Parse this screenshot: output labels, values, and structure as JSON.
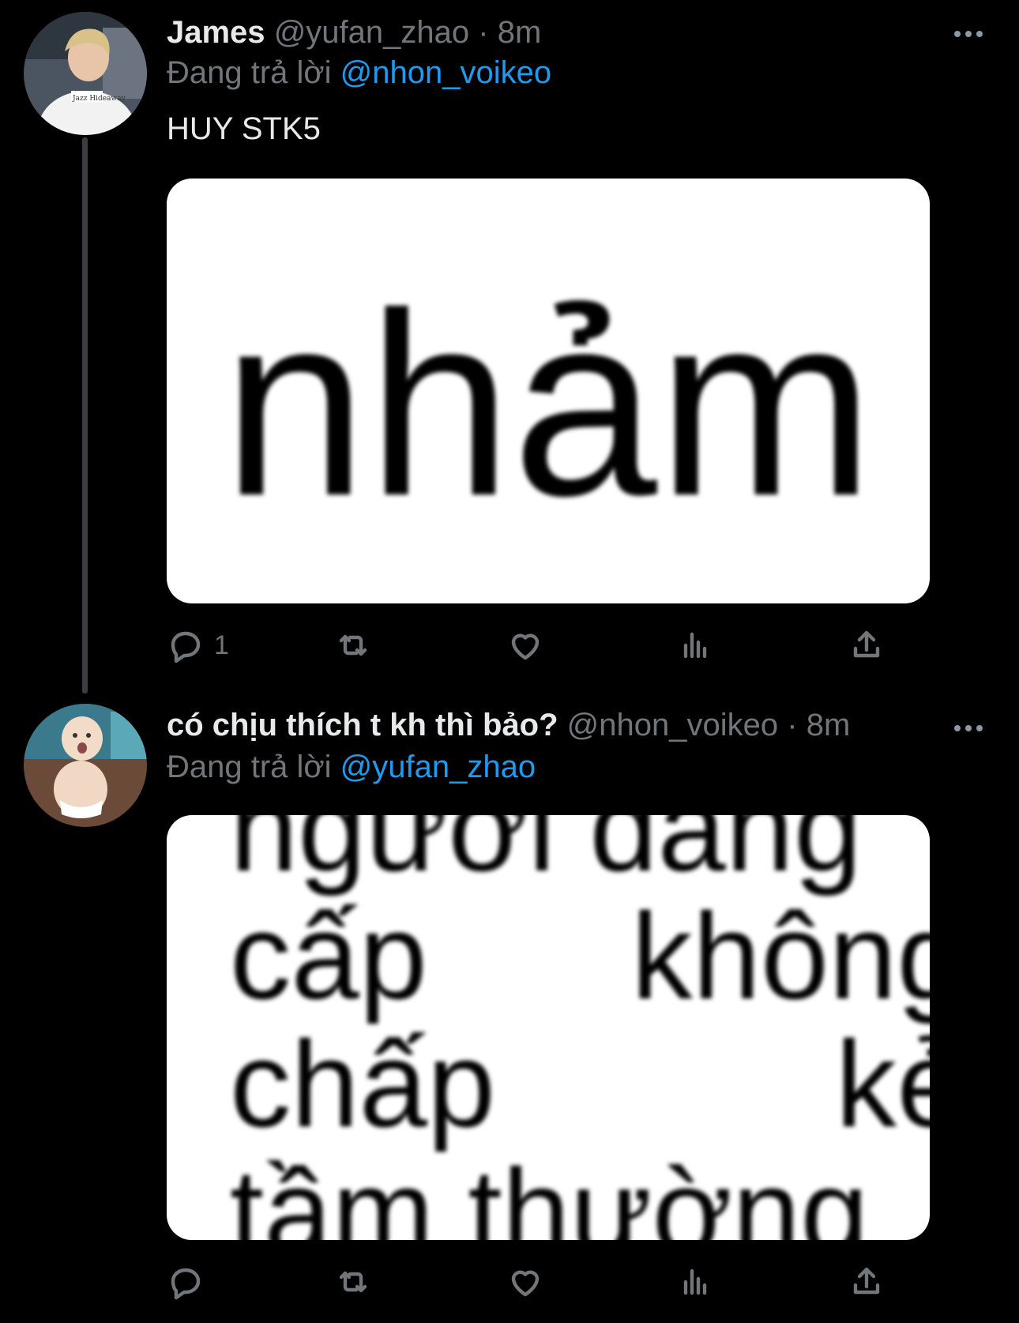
{
  "tweets": [
    {
      "name": "James",
      "handle": "@yufan_zhao",
      "separator": "·",
      "time": "8m",
      "reply_prefix": "Đang trả lời",
      "reply_to": "@nhon_voikeo",
      "text": "HUY STK5",
      "media_text": "nhảm",
      "reply_count": "1",
      "avatar_icon": "user-avatar-blond-icon"
    },
    {
      "name": "có chịu thích t kh thì bảo?",
      "handle": "@nhon_voikeo",
      "separator": "·",
      "time": "8m",
      "reply_prefix": "Đang trả lời",
      "reply_to": "@yufan_zhao",
      "media_lines": [
        "người đẳng",
        "cấp      không",
        "chấp          kẻ",
        "tầm thường"
      ],
      "reply_count": "",
      "avatar_icon": "user-avatar-baby-icon"
    }
  ],
  "colors": {
    "background": "#000000",
    "text": "#e7e9ea",
    "muted": "#71767b",
    "link": "#1d9bf0"
  }
}
